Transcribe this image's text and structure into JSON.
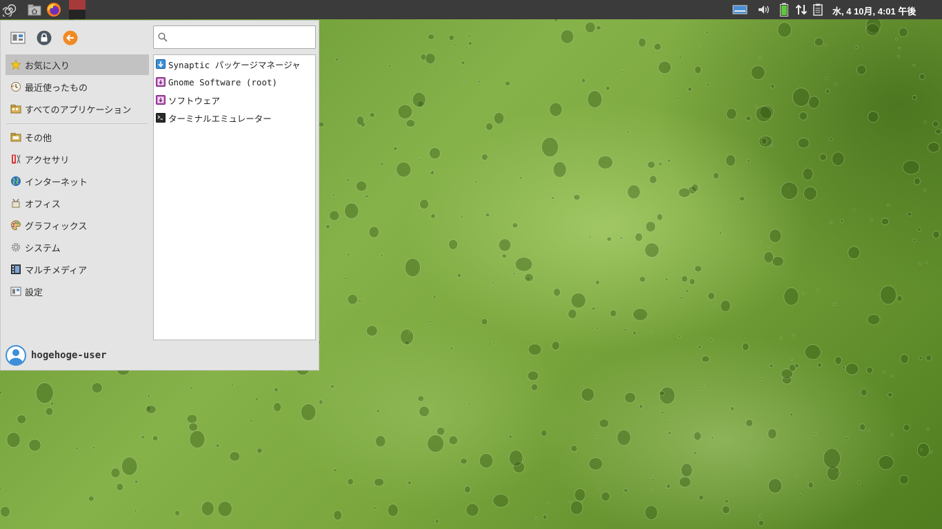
{
  "panel": {
    "launcher_icon": "spiral-menu-icon",
    "home_icon": "home-folder-icon",
    "browser_icon": "firefox-icon",
    "workspace_icon": "workspace-switcher-icon",
    "tray": {
      "keyboard_icon": "keyboard-icon",
      "volume_icon": "volume-icon",
      "battery_icon": "battery-icon",
      "network_icon": "network-updown-icon",
      "clipboard_icon": "clipboard-icon"
    },
    "clock": "水, 4 10月,  4:01 午後"
  },
  "menu": {
    "top_buttons": {
      "settings_icon": "settings-manager-icon",
      "lock_icon": "lock-screen-icon",
      "logout_icon": "log-out-icon"
    },
    "search": {
      "value": "",
      "placeholder": ""
    },
    "categories": [
      {
        "label": "お気に入り",
        "icon": "star-icon",
        "selected": true
      },
      {
        "label": "最近使ったもの",
        "icon": "recent-clock-icon"
      },
      {
        "label": "すべてのアプリケーション",
        "icon": "all-apps-folder-icon"
      },
      {
        "label": "その他",
        "icon": "other-folder-icon"
      },
      {
        "label": "アクセサリ",
        "icon": "accessories-icon"
      },
      {
        "label": "インターネット",
        "icon": "internet-globe-icon"
      },
      {
        "label": "オフィス",
        "icon": "office-icon"
      },
      {
        "label": "グラフィックス",
        "icon": "graphics-palette-icon"
      },
      {
        "label": "システム",
        "icon": "system-gear-icon"
      },
      {
        "label": "マルチメディア",
        "icon": "multimedia-icon"
      },
      {
        "label": "設定",
        "icon": "settings-icon"
      }
    ],
    "apps": [
      {
        "label": "Synaptic パッケージマネージャ",
        "icon": "package-download-icon"
      },
      {
        "label": "Gnome Software (root)",
        "icon": "software-root-icon"
      },
      {
        "label": "ソフトウェア",
        "icon": "software-center-icon"
      },
      {
        "label": "ターミナルエミュレーター",
        "icon": "terminal-icon"
      }
    ],
    "user": {
      "name": "hogehoge-user",
      "icon": "user-avatar-icon"
    }
  },
  "colors": {
    "panel_bg": "#3b3b3b",
    "menu_bg": "#e4e4e4",
    "selected_bg": "#c2c2c2",
    "accent_orange": "#f08a24"
  }
}
